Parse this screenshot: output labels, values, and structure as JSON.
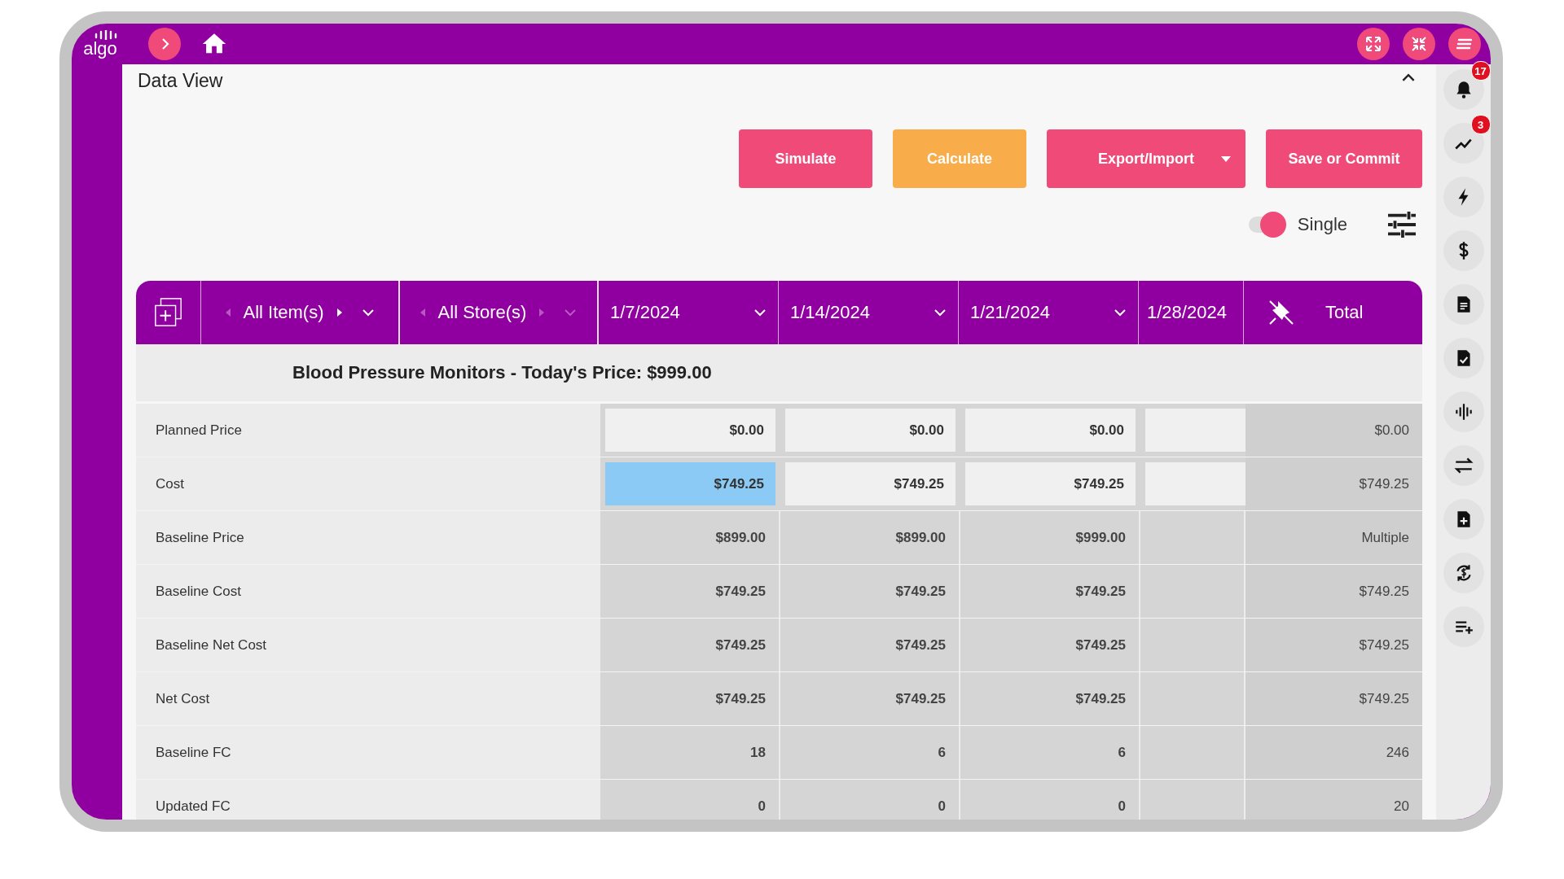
{
  "logo": "algo",
  "page": {
    "title": "Data View",
    "collapsed": false
  },
  "actions": [
    {
      "label": "Simulate",
      "kind": "primary",
      "dropdown": false
    },
    {
      "label": "Calculate",
      "kind": "warning",
      "dropdown": false
    },
    {
      "label": "Export/Import",
      "kind": "primary",
      "dropdown": true
    },
    {
      "label": "Save or Commit",
      "kind": "primary",
      "dropdown": false
    }
  ],
  "mode_toggle": {
    "label": "Single",
    "on": true
  },
  "table": {
    "filters": [
      {
        "label": "All Item(s)",
        "prev_enabled": false,
        "next_enabled": true
      },
      {
        "label": "All Store(s)",
        "prev_enabled": false,
        "next_enabled": false
      }
    ],
    "dates": [
      {
        "label": "1/7/2024",
        "dropdown": true
      },
      {
        "label": "1/14/2024",
        "dropdown": true
      },
      {
        "label": "1/21/2024",
        "dropdown": true
      },
      {
        "label": "1/28/2024",
        "dropdown": false
      }
    ],
    "total_label": "Total",
    "group_title": "Blood Pressure Monitors - Today's Price: $999.00",
    "rows": [
      {
        "label": "Planned Price",
        "editable": true,
        "cells": [
          {
            "value": "$0.00",
            "selected": false
          },
          {
            "value": "$0.00",
            "selected": false
          },
          {
            "value": "$0.00",
            "selected": false
          }
        ],
        "total": "$0.00"
      },
      {
        "label": "Cost",
        "editable": true,
        "cells": [
          {
            "value": "$749.25",
            "selected": true
          },
          {
            "value": "$749.25",
            "selected": false
          },
          {
            "value": "$749.25",
            "selected": false
          }
        ],
        "total": "$749.25"
      },
      {
        "label": "Baseline Price",
        "editable": false,
        "cells": [
          {
            "value": "$899.00",
            "selected": false
          },
          {
            "value": "$899.00",
            "selected": false
          },
          {
            "value": "$999.00",
            "selected": false
          }
        ],
        "total": "Multiple"
      },
      {
        "label": "Baseline Cost",
        "editable": false,
        "cells": [
          {
            "value": "$749.25",
            "selected": false
          },
          {
            "value": "$749.25",
            "selected": false
          },
          {
            "value": "$749.25",
            "selected": false
          }
        ],
        "total": "$749.25"
      },
      {
        "label": "Baseline Net Cost",
        "editable": false,
        "cells": [
          {
            "value": "$749.25",
            "selected": false
          },
          {
            "value": "$749.25",
            "selected": false
          },
          {
            "value": "$749.25",
            "selected": false
          }
        ],
        "total": "$749.25"
      },
      {
        "label": "Net Cost",
        "editable": false,
        "cells": [
          {
            "value": "$749.25",
            "selected": false
          },
          {
            "value": "$749.25",
            "selected": false
          },
          {
            "value": "$749.25",
            "selected": false
          }
        ],
        "total": "$749.25"
      },
      {
        "label": "Baseline FC",
        "editable": false,
        "cells": [
          {
            "value": "18",
            "selected": false
          },
          {
            "value": "6",
            "selected": false
          },
          {
            "value": "6",
            "selected": false
          }
        ],
        "total": "246"
      },
      {
        "label": "Updated FC",
        "editable": false,
        "cells": [
          {
            "value": "0",
            "selected": false
          },
          {
            "value": "0",
            "selected": false
          },
          {
            "value": "0",
            "selected": false
          }
        ],
        "total": "20"
      }
    ]
  },
  "rail": [
    {
      "kind": "bell",
      "badge": "17"
    },
    {
      "kind": "trend",
      "badge": "3"
    },
    {
      "kind": "bolt"
    },
    {
      "kind": "dollar"
    },
    {
      "kind": "document"
    },
    {
      "kind": "doc-check"
    },
    {
      "kind": "wave"
    },
    {
      "kind": "swap"
    },
    {
      "kind": "doc-plus"
    },
    {
      "kind": "currency-sync"
    },
    {
      "kind": "list-add"
    }
  ]
}
